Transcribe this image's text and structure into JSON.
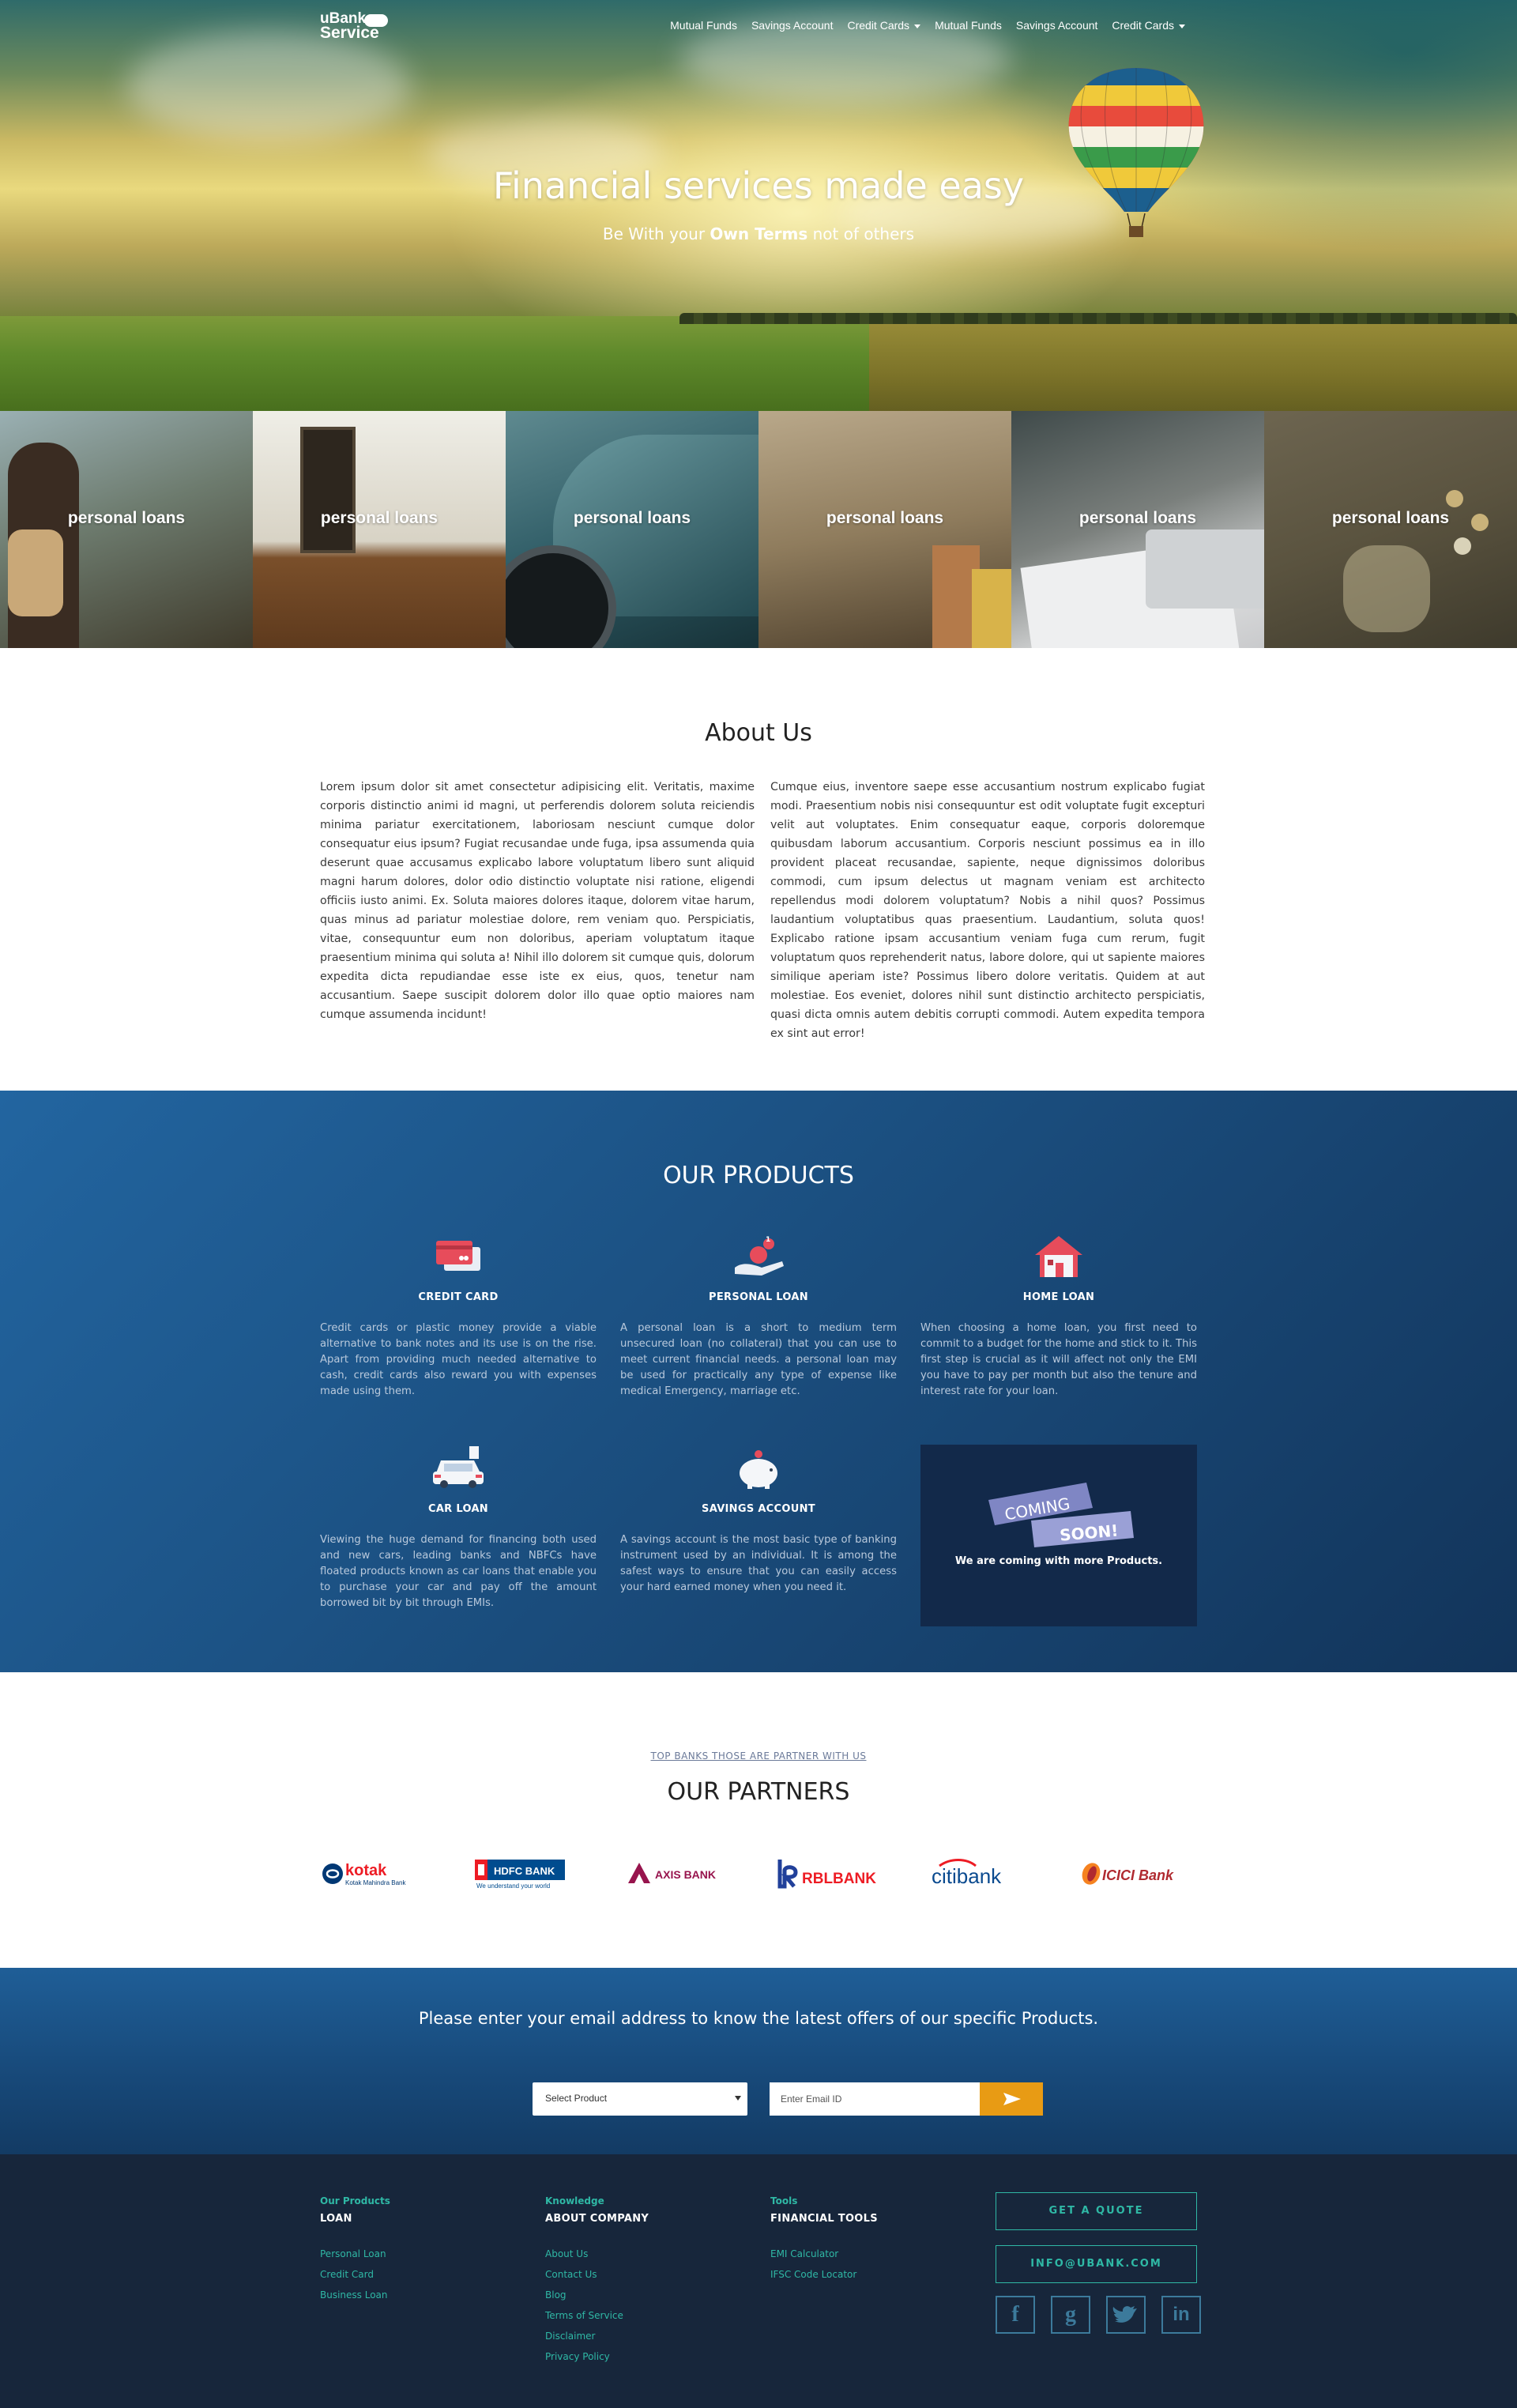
{
  "brand": {
    "line1": "uBank",
    "line2": "Service"
  },
  "nav": {
    "items": [
      {
        "label": "Mutual Funds",
        "dropdown": false
      },
      {
        "label": "Savings Account",
        "dropdown": false
      },
      {
        "label": "Credit Cards",
        "dropdown": true
      },
      {
        "label": "Mutual Funds",
        "dropdown": false
      },
      {
        "label": "Savings Account",
        "dropdown": false
      },
      {
        "label": "Credit Cards",
        "dropdown": true
      }
    ]
  },
  "hero": {
    "title": "Financial services made easy",
    "sub_prefix": "Be With your",
    "sub_bold": "Own Terms",
    "sub_suffix": "not of others"
  },
  "tiles": [
    "personal loans",
    "personal loans",
    "personal loans",
    "personal loans",
    "personal loans",
    "personal loans"
  ],
  "about": {
    "title": "About Us",
    "left": "Lorem ipsum dolor sit amet consectetur adipisicing elit. Veritatis, maxime corporis distinctio animi id magni, ut perferendis dolorem soluta reiciendis minima pariatur exercitationem, laboriosam nesciunt cumque dolor consequatur eius ipsum? Fugiat recusandae unde fuga, ipsa assumenda quia deserunt quae accusamus explicabo labore voluptatum libero sunt aliquid magni harum dolores, dolor odio distinctio voluptate nisi ratione, eligendi officiis iusto animi. Ex. Soluta maiores dolores itaque, dolorem vitae harum, quas minus ad pariatur molestiae dolore, rem veniam quo. Perspiciatis, vitae, consequuntur eum non doloribus, aperiam voluptatum itaque praesentium minima qui soluta a! Nihil illo dolorem sit cumque quis, dolorum expedita dicta repudiandae esse iste ex eius, quos, tenetur nam accusantium. Saepe suscipit dolorem dolor illo quae optio maiores nam cumque assumenda incidunt!",
    "right": "Cumque eius, inventore saepe esse accusantium nostrum explicabo fugiat modi. Praesentium nobis nisi consequuntur est odit voluptate fugit excepturi velit aut voluptates. Enim consequatur eaque, corporis doloremque quibusdam laborum accusantium. Corporis nesciunt possimus ea in illo provident placeat recusandae, sapiente, neque dignissimos doloribus commodi, cum ipsum delectus ut magnam veniam est architecto repellendus modi dolorem voluptatum? Nobis a nihil quos? Possimus laudantium voluptatibus quas praesentium. Laudantium, soluta quos! Explicabo ratione ipsam accusantium veniam fuga cum rerum, fugit voluptatum quos reprehenderit natus, labore dolore, qui ut sapiente maiores similique aperiam iste? Possimus libero dolore veritatis. Quidem at aut molestiae. Eos eveniet, dolores nihil sunt distinctio architecto perspiciatis, quasi dicta omnis autem debitis corrupti commodi. Autem expedita tempora ex sint aut error!"
  },
  "products": {
    "title": "OUR PRODUCTS",
    "items": [
      {
        "name": "CREDIT CARD",
        "icon": "credit-card-icon",
        "desc": "Credit cards or plastic money provide a viable alternative to bank notes and its use is on the rise. Apart from providing much needed alternative to cash, credit cards also reward you with expenses made using them."
      },
      {
        "name": "PERSONAL LOAN",
        "icon": "personal-loan-icon",
        "desc": "A personal loan is a short to medium term unsecured loan (no collateral) that you can use to meet current financial needs. a personal loan may be used for practically any type of expense like medical Emergency, marriage etc."
      },
      {
        "name": "HOME LOAN",
        "icon": "home-icon",
        "desc": "When choosing a home loan, you first need to commit to a budget for the home and stick to it. This first step is crucial as it will affect not only the EMI you have to pay per month but also the tenure and interest rate for your loan."
      },
      {
        "name": "CAR LOAN",
        "icon": "car-icon",
        "desc": "Viewing the huge demand for financing both used and new cars, leading banks and NBFCs have floated products known as car loans that enable you to purchase your car and pay off the amount borrowed bit by bit through EMIs."
      },
      {
        "name": "SAVINGS ACCOUNT",
        "icon": "piggy-bank-icon",
        "desc": "A savings account is the most basic type of banking instrument used by an individual. It is among the safest ways to ensure that you can easily access your hard earned money when you need it."
      }
    ],
    "coming_top": "COMING",
    "coming_bottom": "SOON!",
    "coming_text": "We are coming with more Products.",
    "badge_count": "1"
  },
  "partners": {
    "kicker": "TOP BANKS THOSE ARE PARTNER WITH US",
    "title": "OUR PARTNERS",
    "kotak": {
      "name": "kotak",
      "sub": "Kotak Mahindra Bank"
    },
    "hdfc": {
      "name": "HDFC BANK",
      "sub": "We understand your world"
    },
    "axis": "AXIS BANK",
    "rbl": "RBLBANK",
    "citi": "citibank",
    "icici": "ICICI Bank"
  },
  "subscribe": {
    "text": "Please enter your email address to know the latest offers of our specific Products.",
    "select_value": "Select Product",
    "email_placeholder": "Enter Email ID"
  },
  "footer": {
    "col1": {
      "kicker": "Our Products",
      "head": "LOAN",
      "links": [
        "Personal Loan",
        "Credit Card",
        "Business Loan"
      ]
    },
    "col2": {
      "kicker": "Knowledge",
      "head": "ABOUT COMPANY",
      "links": [
        "About Us",
        "Contact Us",
        "Blog",
        "Terms of Service",
        "Disclaimer",
        "Privacy Policy"
      ]
    },
    "col3": {
      "kicker": "Tools",
      "head": "FINANCIAL TOOLS",
      "links": [
        "EMI Calculator",
        "IFSC Code Locator"
      ]
    },
    "quote_button": "GET A QUOTE",
    "email_button": "INFO@UBANK.COM",
    "social": [
      "f",
      "g",
      "t",
      "in"
    ]
  },
  "colors": {
    "accent": "#e89b14",
    "teal": "#2fb8a5",
    "products_bg": "#1b4f80",
    "footer_bg": "#17263b"
  }
}
